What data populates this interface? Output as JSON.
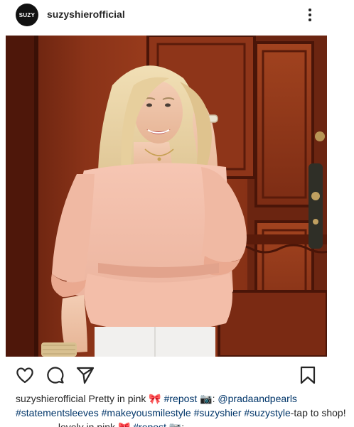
{
  "post": {
    "avatar_text": "SUZY",
    "username": "suzyshierofficial"
  },
  "photo": {
    "description_icon": "photo-image"
  },
  "actions": {
    "like_icon": "heart-icon",
    "comment_icon": "comment-icon",
    "share_icon": "paper-plane-icon",
    "save_icon": "bookmark-icon"
  },
  "caption": {
    "username": "suzyshierofficial",
    "text1": "Pretty in pink",
    "emoji_bow": "🎀",
    "tag_repost": "#repost",
    "emoji_camera": "📷",
    "colon": ":",
    "mention": "@pradaandpearls",
    "tag_statementsleeves": "#statementsleeves",
    "tag_makeyousmile": "#makeyousmilestyle",
    "tag_suzyshier": "#suzyshier",
    "tag_suzystyle": "#suzystyle",
    "text2": "-tap to shop! ———— lovely in pink",
    "emoji_bow2": "🎀",
    "tag_repost2": "#repost",
    "emoji_camera2": "📷",
    "colon2": ":"
  },
  "colors": {
    "accent_link": "#003569",
    "text": "#262626",
    "door_wood": "#7a2a14",
    "blouse": "#f2bca8"
  }
}
